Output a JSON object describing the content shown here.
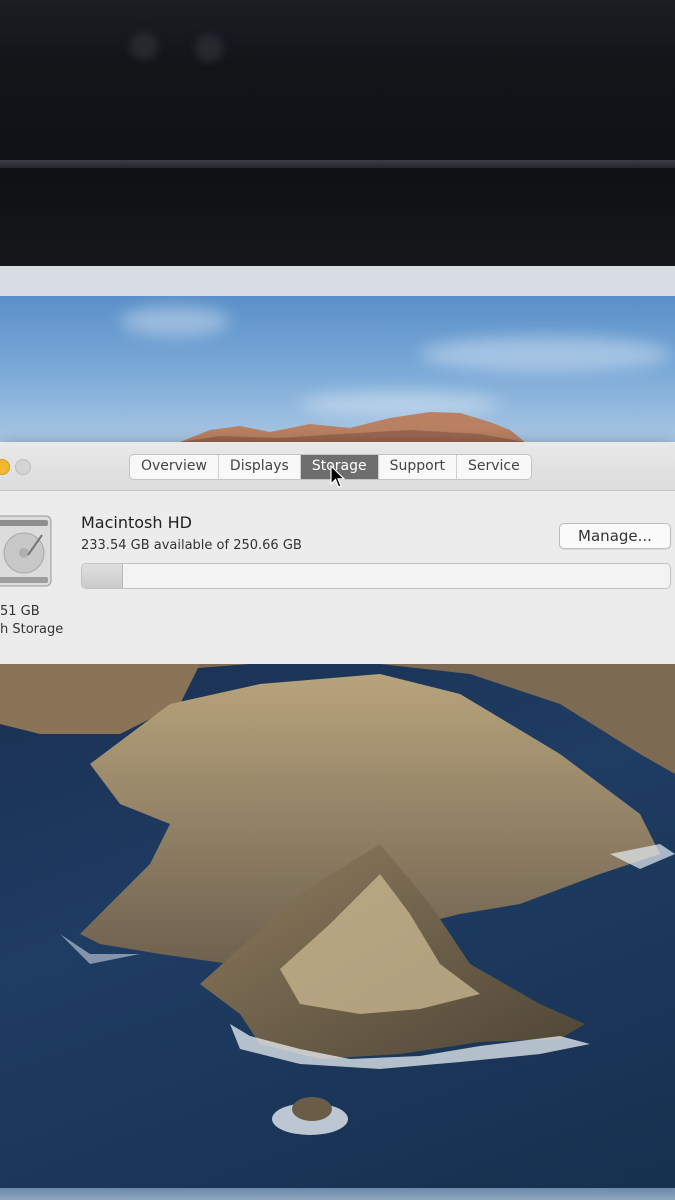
{
  "window": {
    "tabs": [
      {
        "label": "Overview",
        "active": false
      },
      {
        "label": "Displays",
        "active": false
      },
      {
        "label": "Storage",
        "active": true
      },
      {
        "label": "Support",
        "active": false
      },
      {
        "label": "Service",
        "active": false
      }
    ]
  },
  "storage": {
    "volume_name": "Macintosh HD",
    "available_text": "233.54 GB available of 250.66 GB",
    "disk_size_partial": "51 GB",
    "disk_type_partial": "h Storage",
    "manage_label": "Manage...",
    "used_fraction": 0.068
  },
  "colors": {
    "active_tab": "#6e6e6e",
    "window_bg": "#ececec",
    "traffic_yellow": "#f0b930"
  },
  "icons": [
    "hard-drive-icon",
    "cursor-arrow-icon"
  ]
}
